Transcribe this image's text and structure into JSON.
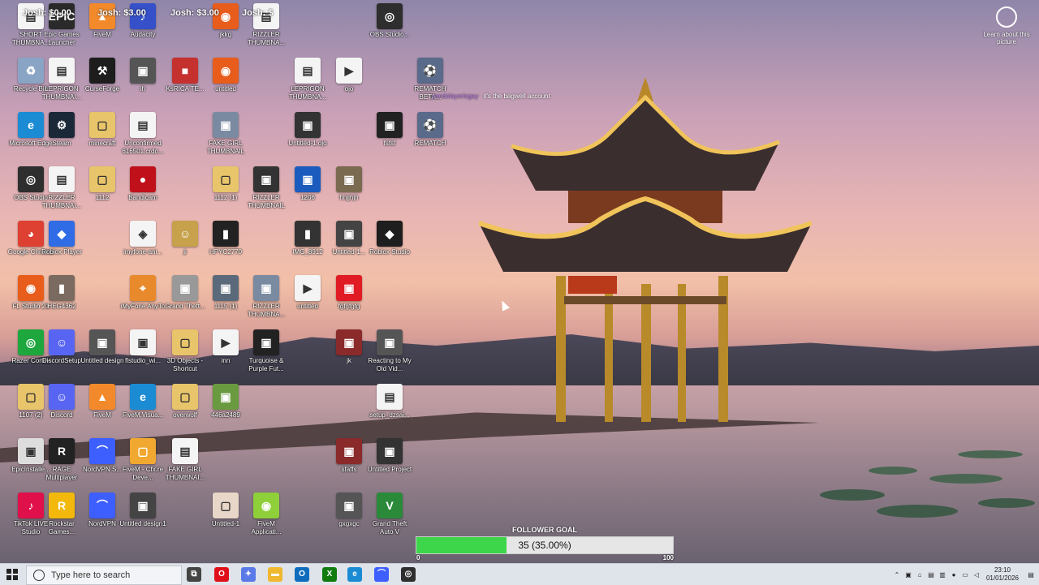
{
  "overlay": {
    "top_left_left": "Josh: $0.00",
    "top_left_mid": "Josh: $3.00",
    "top_left_right": "Josh: $3.00",
    "top_left_far": "Josh: $"
  },
  "chat": {
    "user": "yendslayerisgay",
    "message": "it's the bagwell account"
  },
  "learn": {
    "label": "Learn about this picture",
    "icon": "camera-icon"
  },
  "follower_goal": {
    "title": "FOLLOWER GOAL",
    "text": "35 (35.00%)",
    "progress": 0.35,
    "min": "0",
    "max": "100"
  },
  "icons": [
    {
      "label": "SHORT THUMBNA...",
      "color": "#f4f4f4",
      "glyph": "▤"
    },
    {
      "label": "Epic Games Launcher",
      "color": "#2a2a2a",
      "glyph": "EPIC"
    },
    {
      "label": "FiveM",
      "color": "#f28a2b",
      "glyph": "▲"
    },
    {
      "label": "Audacity",
      "color": "#3550c8",
      "glyph": "♪"
    },
    {
      "label": "jkkg",
      "color": "#e85d1c",
      "glyph": "◉"
    },
    {
      "label": "RIZZLER THUMBNA...",
      "color": "#f4f4f4",
      "glyph": "▤"
    },
    {
      "label": "OBS Studio...",
      "color": "#2e2e2e",
      "glyph": "◎"
    },
    {
      "label": "Recycle Bin",
      "color": "#8aa4c6",
      "glyph": "♻"
    },
    {
      "label": "LEPRIGON THUMBNAI...",
      "color": "#f4f4f4",
      "glyph": "▤"
    },
    {
      "label": "CurseForge",
      "color": "#1d1d1d",
      "glyph": "⚒"
    },
    {
      "label": "ih",
      "color": "#555",
      "glyph": "▣"
    },
    {
      "label": "KsRICA TE...",
      "color": "#c4312f",
      "glyph": "■"
    },
    {
      "label": "untitled",
      "color": "#e85d1c",
      "glyph": "◉"
    },
    {
      "label": "LEPRIGON THUMBNA...",
      "color": "#f4f4f4",
      "glyph": "▤"
    },
    {
      "label": "ojo",
      "color": "#f4f4f4",
      "glyph": "▶"
    },
    {
      "label": "REMATCH BETA...",
      "color": "#5a6a8a",
      "glyph": "⚽"
    },
    {
      "label": "Microsoft Edge",
      "color": "#1b8bd4",
      "glyph": "e"
    },
    {
      "label": "Steam",
      "color": "#1b2838",
      "glyph": "⚙"
    },
    {
      "label": "minecraft",
      "color": "#e8c46a",
      "glyph": "▢"
    },
    {
      "label": "Unconfirmed 616501.crdo...",
      "color": "#f4f4f4",
      "glyph": "▤"
    },
    {
      "label": "FAKE GIRL THUMBNAIL",
      "color": "#7a8aa0",
      "glyph": "▣"
    },
    {
      "label": "Untitled-1.ojo",
      "color": "#333",
      "glyph": "▣"
    },
    {
      "label": "fsfsf",
      "color": "#222",
      "glyph": "▣"
    },
    {
      "label": "REMATCH",
      "color": "#5a6a8a",
      "glyph": "⚽"
    },
    {
      "label": "OBS Studio",
      "color": "#2e2e2e",
      "glyph": "◎"
    },
    {
      "label": "RIZZLER THUMBNAI...",
      "color": "#f4f4f4",
      "glyph": "▤"
    },
    {
      "label": "1112",
      "color": "#e8c46a",
      "glyph": "▢"
    },
    {
      "label": "Bandicam",
      "color": "#c0101a",
      "glyph": "●"
    },
    {
      "label": "1112 (1)",
      "color": "#e8c46a",
      "glyph": "▢"
    },
    {
      "label": "RIZZLER THUMBNAIL",
      "color": "#333",
      "glyph": "▣"
    },
    {
      "label": "1206",
      "color": "#1a5bbd",
      "glyph": "▣"
    },
    {
      "label": "hhjjhjh",
      "color": "#7a6a50",
      "glyph": "▣"
    },
    {
      "label": "Google Chrome",
      "color": "#de4032",
      "glyph": "◕"
    },
    {
      "label": "Roblox Player",
      "color": "#2f6ce6",
      "glyph": "◆"
    },
    {
      "label": "imyfone-ani...",
      "color": "#f4f4f4",
      "glyph": "◈"
    },
    {
      "label": "ji",
      "color": "#c7a14b",
      "glyph": "☺"
    },
    {
      "label": "HPYC2770",
      "color": "#222",
      "glyph": "▮"
    },
    {
      "label": "IMG_8912",
      "color": "#333",
      "glyph": "▮"
    },
    {
      "label": "Untitled-1...",
      "color": "#444",
      "glyph": "▣"
    },
    {
      "label": "Roblox Studio",
      "color": "#1e1e1e",
      "glyph": "◆"
    },
    {
      "label": "FL Studio 21",
      "color": "#e85d1c",
      "glyph": "◉"
    },
    {
      "label": "HEG4362",
      "color": "#7a6a60",
      "glyph": "▮"
    },
    {
      "label": "iMyFone AnyTo",
      "color": "#e88a2b",
      "glyph": "⌖"
    },
    {
      "label": "Grand Theft...",
      "color": "#999",
      "glyph": "▣"
    },
    {
      "label": "1115 (1)",
      "color": "#5a6a7a",
      "glyph": "▣"
    },
    {
      "label": "RIZZLER THUMBNA...",
      "color": "#7a8aa0",
      "glyph": "▣"
    },
    {
      "label": "untitled",
      "color": "#f4f4f4",
      "glyph": "▶"
    },
    {
      "label": "fgfgfgfg",
      "color": "#e01b24",
      "glyph": "▣"
    },
    {
      "label": "Razer Cortex",
      "color": "#1ea73d",
      "glyph": "◎"
    },
    {
      "label": "DiscordSetup",
      "color": "#5865f2",
      "glyph": "☺"
    },
    {
      "label": "Untitled design",
      "color": "#555",
      "glyph": "▣"
    },
    {
      "label": "flstudio_wi...",
      "color": "#f4f4f4",
      "glyph": "▣"
    },
    {
      "label": "3D Objects - Shortcut",
      "color": "#e8c46a",
      "glyph": "▢"
    },
    {
      "label": "inn",
      "color": "#f4f4f4",
      "glyph": "▶"
    },
    {
      "label": "Turquoise & Purple Fut...",
      "color": "#222",
      "glyph": "▣"
    },
    {
      "label": "jk",
      "color": "#8a2a2a",
      "glyph": "▣"
    },
    {
      "label": "Reacting to My Old Vid...",
      "color": "#555",
      "glyph": "▣"
    },
    {
      "label": "1107 (2)",
      "color": "#e8c46a",
      "glyph": "▢"
    },
    {
      "label": "Discord",
      "color": "#5865f2",
      "glyph": "☺"
    },
    {
      "label": "FiveM",
      "color": "#f28a2b",
      "glyph": "▲"
    },
    {
      "label": "FiveM.Visua...",
      "color": "#1b8bd4",
      "glyph": "e"
    },
    {
      "label": "overwolf",
      "color": "#e8c46a",
      "glyph": "▢"
    },
    {
      "label": "446a2489",
      "color": "#6a9a40",
      "glyph": "▣"
    },
    {
      "label": "setup_dzsai...",
      "color": "#f4f4f4",
      "glyph": "▤"
    },
    {
      "label": "EpicInstalle...",
      "color": "#ddd",
      "glyph": "▣"
    },
    {
      "label": "RAGE Multiplayer",
      "color": "#222",
      "glyph": "R"
    },
    {
      "label": "NordVPN S...",
      "color": "#3e5fff",
      "glyph": "⌒"
    },
    {
      "label": "FiveM - Cfx.re Deve...",
      "color": "#f0a830",
      "glyph": "▢"
    },
    {
      "label": "FAKE GIRL THUMBNAI...",
      "color": "#f4f4f4",
      "glyph": "▤"
    },
    {
      "label": "sfaffs",
      "color": "#8a2a2a",
      "glyph": "▣"
    },
    {
      "label": "Untitled Project",
      "color": "#333",
      "glyph": "▣"
    },
    {
      "label": "TikTok LIVE Studio",
      "color": "#e0104a",
      "glyph": "♪"
    },
    {
      "label": "Rockstar Games...",
      "color": "#f2b90c",
      "glyph": "R"
    },
    {
      "label": "NordVPN",
      "color": "#3e5fff",
      "glyph": "⌒"
    },
    {
      "label": "Untitled design1",
      "color": "#444",
      "glyph": "▣"
    },
    {
      "label": "Untitled-1",
      "color": "#e8d6c8",
      "glyph": "▢"
    },
    {
      "label": "FiveM Applicati...",
      "color": "#8fcf3a",
      "glyph": "◉"
    },
    {
      "label": "gxgxgc",
      "color": "#555",
      "glyph": "▣"
    },
    {
      "label": "Grand Theft Auto V",
      "color": "#2a8a3a",
      "glyph": "V"
    }
  ],
  "taskbar": {
    "search_placeholder": "Type here to search",
    "apps": [
      {
        "name": "task-view-icon",
        "color": "#444",
        "glyph": "⧉"
      },
      {
        "name": "opera-icon",
        "color": "#e0101a",
        "glyph": "O"
      },
      {
        "name": "copilot-icon",
        "color": "#5a7ae8",
        "glyph": "✦"
      },
      {
        "name": "file-explorer-icon",
        "color": "#f0b830",
        "glyph": "▬"
      },
      {
        "name": "outlook-icon",
        "color": "#0f6cbd",
        "glyph": "O"
      },
      {
        "name": "xbox-icon",
        "color": "#107c10",
        "glyph": "X"
      },
      {
        "name": "edge-icon",
        "color": "#1b8bd4",
        "glyph": "e"
      },
      {
        "name": "nordvpn-icon",
        "color": "#3e5fff",
        "glyph": "⌒"
      },
      {
        "name": "obs-icon",
        "color": "#2e2e2e",
        "glyph": "◎"
      }
    ],
    "time": "23:10",
    "date": "01/01/2026"
  }
}
